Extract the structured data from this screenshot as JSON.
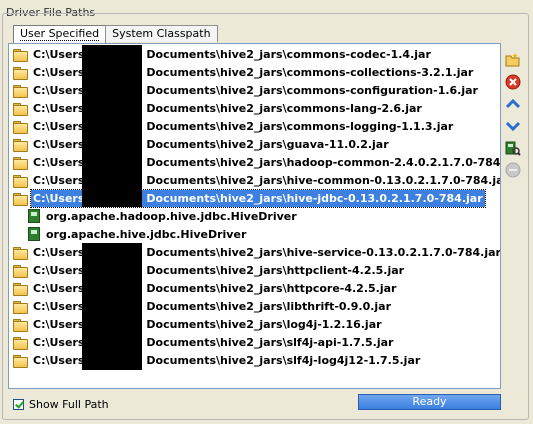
{
  "group": {
    "title": "Driver File Paths"
  },
  "tabs": [
    {
      "label": "User Specified",
      "active": true
    },
    {
      "label": "System Classpath",
      "active": false
    }
  ],
  "rows_before": [
    {
      "prefix": "C:\\Users",
      "suffix": "Documents\\hive2_jars\\commons-codec-1.4.jar"
    },
    {
      "prefix": "C:\\Users",
      "suffix": "Documents\\hive2_jars\\commons-collections-3.2.1.jar"
    },
    {
      "prefix": "C:\\Users",
      "suffix": "Documents\\hive2_jars\\commons-configuration-1.6.jar"
    },
    {
      "prefix": "C:\\Users",
      "suffix": "Documents\\hive2_jars\\commons-lang-2.6.jar"
    },
    {
      "prefix": "C:\\Users",
      "suffix": "Documents\\hive2_jars\\commons-logging-1.1.3.jar"
    },
    {
      "prefix": "C:\\Users",
      "suffix": "Documents\\hive2_jars\\guava-11.0.2.jar"
    },
    {
      "prefix": "C:\\Users",
      "suffix": "Documents\\hive2_jars\\hadoop-common-2.4.0.2.1.7.0-784.jar"
    },
    {
      "prefix": "C:\\Users",
      "suffix": "Documents\\hive2_jars\\hive-common-0.13.0.2.1.7.0-784.jar"
    }
  ],
  "selected_row": {
    "prefix": "C:\\Users",
    "suffix": "Documents\\hive2_jars\\hive-jdbc-0.13.0.2.1.7.0-784.jar"
  },
  "drivers": [
    "org.apache.hadoop.hive.jdbc.HiveDriver",
    "org.apache.hive.jdbc.HiveDriver"
  ],
  "rows_after": [
    {
      "prefix": "C:\\Users",
      "suffix": "Documents\\hive2_jars\\hive-service-0.13.0.2.1.7.0-784.jar"
    },
    {
      "prefix": "C:\\Users",
      "suffix": "Documents\\hive2_jars\\httpclient-4.2.5.jar"
    },
    {
      "prefix": "C:\\Users",
      "suffix": "Documents\\hive2_jars\\httpcore-4.2.5.jar"
    },
    {
      "prefix": "C:\\Users",
      "suffix": "Documents\\hive2_jars\\libthrift-0.9.0.jar"
    },
    {
      "prefix": "C:\\Users",
      "suffix": "Documents\\hive2_jars\\log4j-1.2.16.jar"
    },
    {
      "prefix": "C:\\Users",
      "suffix": "Documents\\hive2_jars\\slf4j-api-1.7.5.jar"
    },
    {
      "prefix": "C:\\Users",
      "suffix": "Documents\\hive2_jars\\slf4j-log4j12-1.7.5.jar"
    }
  ],
  "side_buttons": [
    "add-folder-icon",
    "remove-icon",
    "move-up-icon",
    "move-down-icon",
    "list-drivers-icon",
    "disabled-icon"
  ],
  "footer": {
    "show_full_path_label": "Show Full Path",
    "show_full_path_checked": true,
    "status": "Ready"
  },
  "colors": {
    "selection": "#3d80df",
    "progress": "#3b7fe0",
    "remove": "#d83a2a",
    "arrows": "#2a6fd0"
  }
}
